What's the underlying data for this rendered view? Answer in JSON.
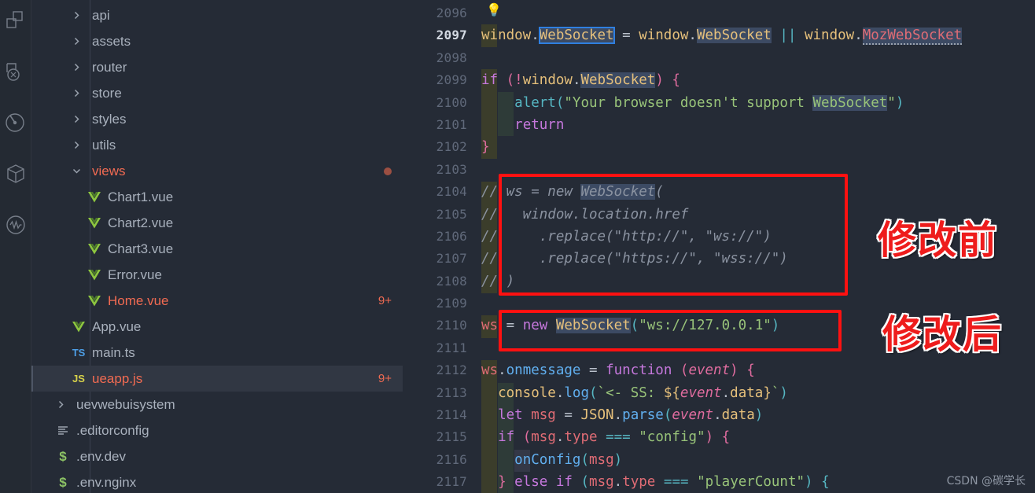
{
  "activity_bar": {
    "icons": [
      {
        "name": "extensions-icon",
        "title": "Extensions"
      },
      {
        "name": "remote-explorer-icon",
        "title": "Remote Explorer"
      },
      {
        "name": "testing-icon",
        "title": "Testing"
      },
      {
        "name": "package-icon",
        "title": "Package"
      },
      {
        "name": "activity-monitor-icon",
        "title": "Monitor"
      }
    ]
  },
  "explorer": {
    "items": [
      {
        "label": "api",
        "kind": "folder",
        "depth": 1,
        "expanded": false,
        "state": "normal"
      },
      {
        "label": "assets",
        "kind": "folder",
        "depth": 1,
        "expanded": false,
        "state": "normal"
      },
      {
        "label": "router",
        "kind": "folder",
        "depth": 1,
        "expanded": false,
        "state": "normal"
      },
      {
        "label": "store",
        "kind": "folder",
        "depth": 1,
        "expanded": false,
        "state": "normal"
      },
      {
        "label": "styles",
        "kind": "folder",
        "depth": 1,
        "expanded": false,
        "state": "normal"
      },
      {
        "label": "utils",
        "kind": "folder",
        "depth": 1,
        "expanded": false,
        "state": "normal"
      },
      {
        "label": "views",
        "kind": "folder",
        "depth": 1,
        "expanded": true,
        "state": "modified",
        "dot": true
      },
      {
        "label": "Chart1.vue",
        "kind": "vue",
        "depth": 2,
        "state": "normal"
      },
      {
        "label": "Chart2.vue",
        "kind": "vue",
        "depth": 2,
        "state": "normal"
      },
      {
        "label": "Chart3.vue",
        "kind": "vue",
        "depth": 2,
        "state": "normal"
      },
      {
        "label": "Error.vue",
        "kind": "vue",
        "depth": 2,
        "state": "normal"
      },
      {
        "label": "Home.vue",
        "kind": "vue",
        "depth": 2,
        "state": "modified",
        "badge": "9+"
      },
      {
        "label": "App.vue",
        "kind": "vue",
        "depth": 1,
        "state": "normal"
      },
      {
        "label": "main.ts",
        "kind": "ts",
        "depth": 1,
        "state": "normal"
      },
      {
        "label": "ueapp.js",
        "kind": "js",
        "depth": 1,
        "state": "modified",
        "badge": "9+",
        "selected": true
      },
      {
        "label": "uevwebuisystem",
        "kind": "folder",
        "depth": 0,
        "expanded": false,
        "state": "normal"
      },
      {
        "label": ".editorconfig",
        "kind": "cfg",
        "depth": 0,
        "state": "normal"
      },
      {
        "label": ".env.dev",
        "kind": "env",
        "depth": 0,
        "state": "normal"
      },
      {
        "label": ".env.nginx",
        "kind": "env",
        "depth": 0,
        "state": "normal"
      }
    ]
  },
  "editor": {
    "first_line_number": 2096,
    "active_line_number": 2097,
    "line_numbers": [
      2096,
      2097,
      2098,
      2099,
      2100,
      2101,
      2102,
      2103,
      2104,
      2105,
      2106,
      2107,
      2108,
      2109,
      2110,
      2111,
      2112,
      2113,
      2114,
      2115,
      2116,
      2117
    ],
    "lightbulb_icon": "lightbulb-icon",
    "lines": [
      {
        "n": 2096,
        "text": ""
      },
      {
        "n": 2097,
        "text": "window.WebSocket = window.WebSocket || window.MozWebSocket"
      },
      {
        "n": 2098,
        "text": ""
      },
      {
        "n": 2099,
        "text": "if (!window.WebSocket) {"
      },
      {
        "n": 2100,
        "text": "    alert(\"Your browser doesn't support WebSocket\")"
      },
      {
        "n": 2101,
        "text": "    return"
      },
      {
        "n": 2102,
        "text": "}"
      },
      {
        "n": 2103,
        "text": ""
      },
      {
        "n": 2104,
        "text": "// ws = new WebSocket("
      },
      {
        "n": 2105,
        "text": "//   window.location.href"
      },
      {
        "n": 2106,
        "text": "//     .replace(\"http://\", \"ws://\")"
      },
      {
        "n": 2107,
        "text": "//     .replace(\"https://\", \"wss://\")"
      },
      {
        "n": 2108,
        "text": "// )"
      },
      {
        "n": 2109,
        "text": ""
      },
      {
        "n": 2110,
        "text": "ws = new WebSocket(\"ws://127.0.0.1\")"
      },
      {
        "n": 2111,
        "text": ""
      },
      {
        "n": 2112,
        "text": "ws.onmessage = function (event) {"
      },
      {
        "n": 2113,
        "text": "  console.log(`<- SS: ${event.data}`)"
      },
      {
        "n": 2114,
        "text": "  let msg = JSON.parse(event.data)"
      },
      {
        "n": 2115,
        "text": "  if (msg.type === \"config\") {"
      },
      {
        "n": 2116,
        "text": "    onConfig(msg)"
      },
      {
        "n": 2117,
        "text": "  } else if (msg.type === \"playerCount\") {"
      }
    ]
  },
  "annotations": {
    "before_label": "修改前",
    "after_label": "修改后",
    "box_color": "#ff1111",
    "text_color": "#ee1c1c"
  },
  "watermark": {
    "text": "CSDN @碳学长"
  }
}
